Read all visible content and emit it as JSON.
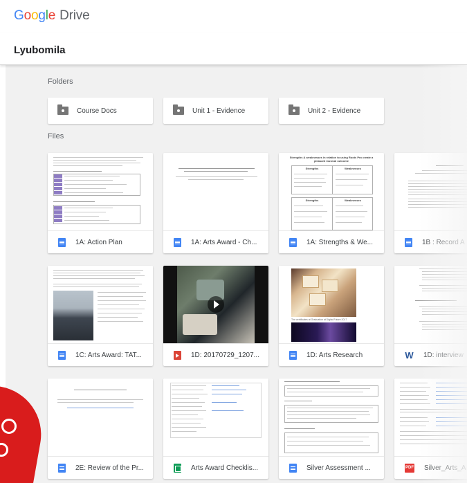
{
  "app": {
    "logo_letters": [
      "G",
      "o",
      "o",
      "g",
      "l",
      "e"
    ],
    "logo_product": "Drive"
  },
  "owner": {
    "name": "Lyubomila"
  },
  "sections": {
    "folders": "Folders",
    "files": "Files"
  },
  "folders": [
    {
      "label": "Course Docs",
      "icon": "folder-shared-icon"
    },
    {
      "label": "Unit 1 - Evidence",
      "icon": "folder-shared-icon"
    },
    {
      "label": "Unit 2 - Evidence",
      "icon": "folder-shared-icon"
    }
  ],
  "files": [
    {
      "name": "1A: Action Plan",
      "type": "doc",
      "icon": "google-docs-icon"
    },
    {
      "name": "1A: Arts Award - Ch...",
      "type": "doc",
      "icon": "google-docs-icon"
    },
    {
      "name": "1A: Strengths & We...",
      "type": "doc",
      "icon": "google-docs-icon"
    },
    {
      "name": "1B : Record A",
      "type": "doc",
      "icon": "google-docs-icon"
    },
    {
      "name": "1C: Arts Award: TAT...",
      "type": "doc",
      "icon": "google-docs-icon"
    },
    {
      "name": "1D: 20170729_1207...",
      "type": "video",
      "icon": "video-file-icon"
    },
    {
      "name": "1D: Arts Research",
      "type": "doc",
      "icon": "google-docs-icon"
    },
    {
      "name": "1D: interview",
      "type": "word",
      "icon": "word-file-icon",
      "icon_glyph": "W"
    },
    {
      "name": "2E: Review of the Pr...",
      "type": "doc",
      "icon": "google-docs-icon"
    },
    {
      "name": "Arts Award Checklis...",
      "type": "sheet",
      "icon": "google-sheets-icon"
    },
    {
      "name": "Silver Assessment ...",
      "type": "doc",
      "icon": "google-docs-icon"
    },
    {
      "name": "Silver_Arts_A",
      "type": "pdf",
      "icon": "pdf-file-icon",
      "icon_glyph": "PDF"
    }
  ],
  "thumb_text": {
    "strengths_title": "Strengths & weaknesses in relation to using Roots Pro create a pleasant musical outcome",
    "strengths_col1": "Strengths",
    "strengths_col2": "Weaknesses",
    "arts_research_caption": "The certificates at Graduation at Digital Future 2017"
  },
  "colors": {
    "content_bg": "#f1f1f1",
    "docs_blue": "#4285f4",
    "sheets_green": "#0f9d58",
    "video_red": "#db4437",
    "pdf_red": "#e53935",
    "word_blue": "#2b579a",
    "badge_red": "#d91c1c"
  }
}
